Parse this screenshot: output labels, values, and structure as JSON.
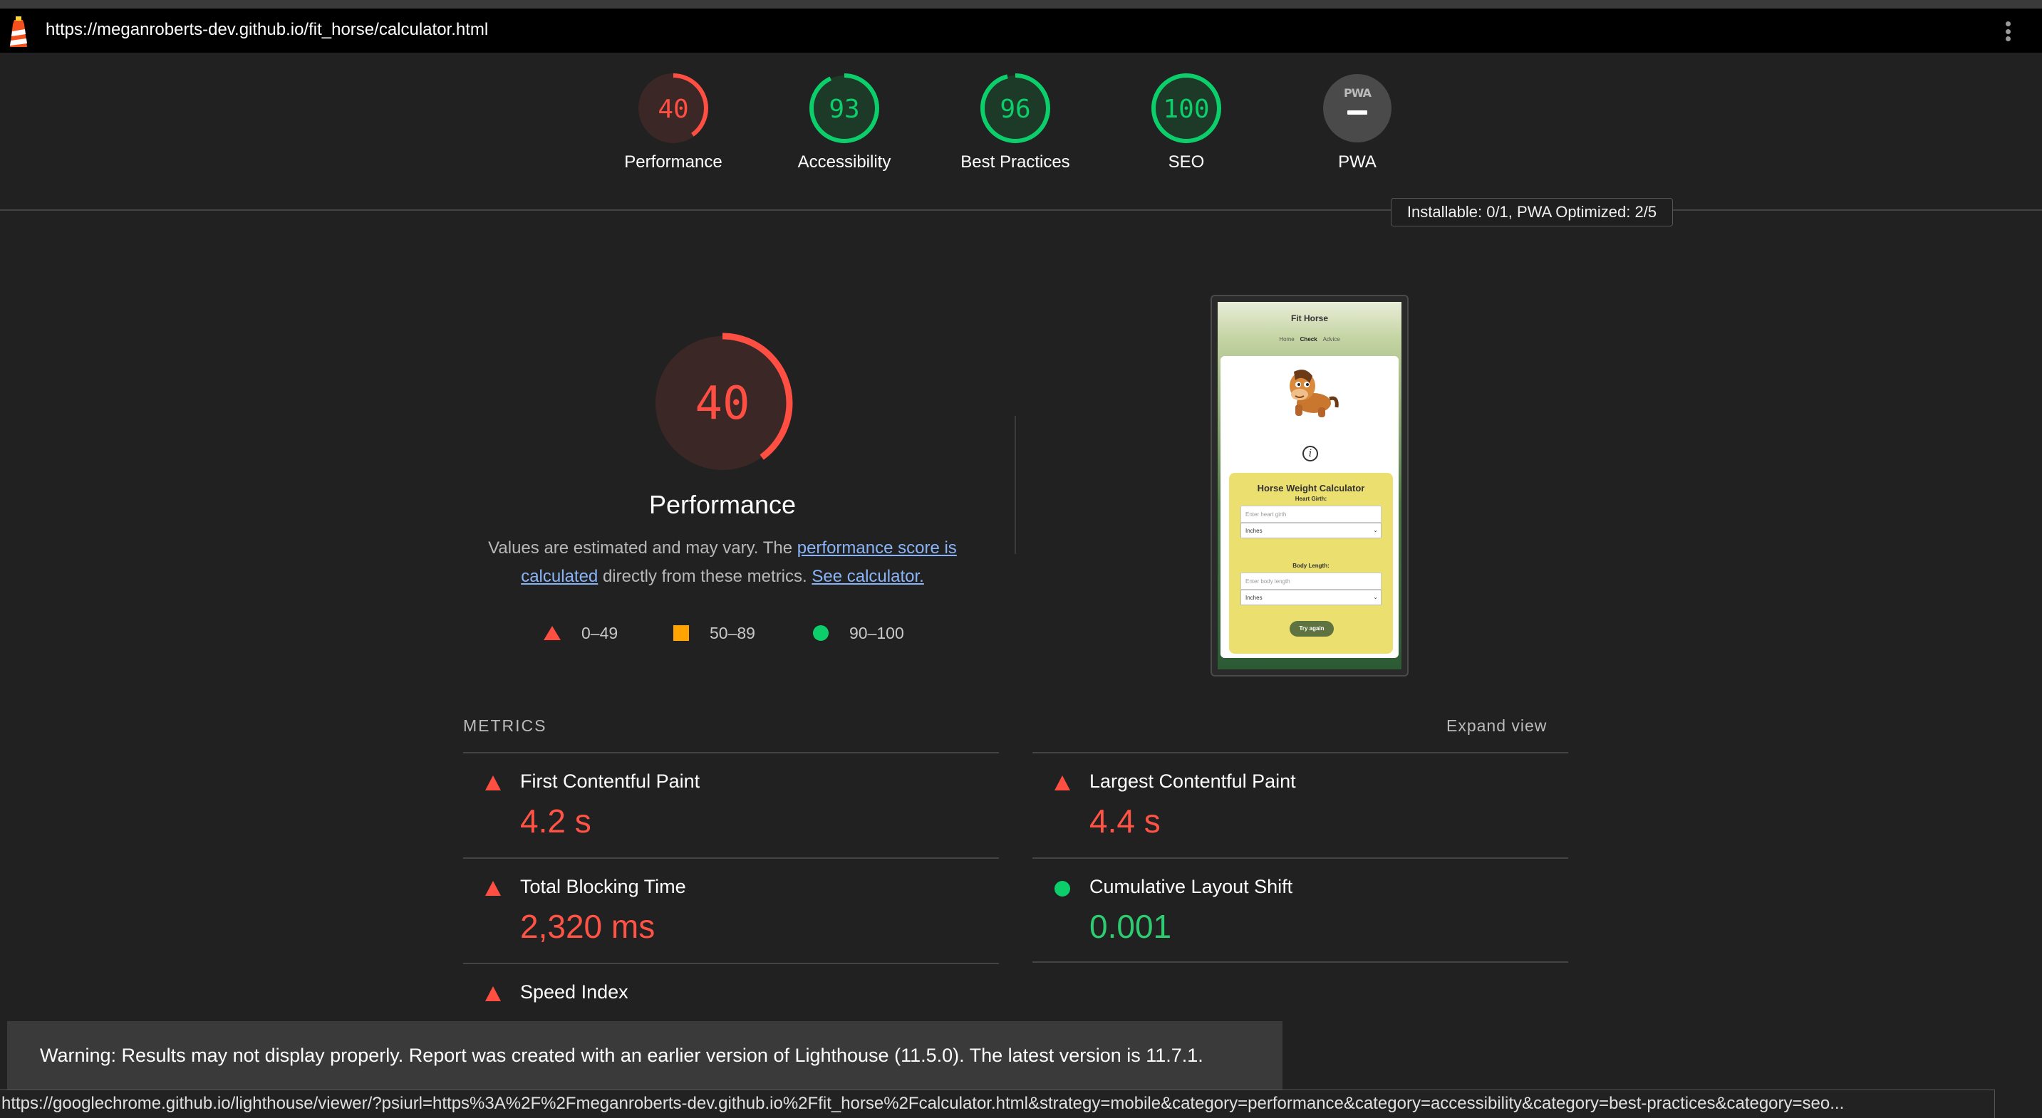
{
  "browser": {
    "url": "https://meganroberts-dev.github.io/fit_horse/calculator.html"
  },
  "gauges": [
    {
      "label": "Performance",
      "score": "40",
      "value": 0.4,
      "status": "fail"
    },
    {
      "label": "Accessibility",
      "score": "93",
      "value": 0.93,
      "status": "pass"
    },
    {
      "label": "Best Practices",
      "score": "96",
      "value": 0.96,
      "status": "pass"
    },
    {
      "label": "SEO",
      "score": "100",
      "value": 1.0,
      "status": "pass"
    },
    {
      "label": "PWA",
      "badge": "PWA",
      "status": "na"
    }
  ],
  "pwa_tooltip": "Installable: 0/1, PWA Optimized: 2/5",
  "performance": {
    "score": "40",
    "value": 0.4,
    "title": "Performance",
    "desc_before": "Values are estimated and may vary. The ",
    "desc_link1": "performance score is calculated",
    "desc_middle": " directly from these metrics. ",
    "desc_link2": "See calculator."
  },
  "legend": [
    {
      "range": "0–49",
      "shape": "triangle",
      "color": "#ff4e42"
    },
    {
      "range": "50–89",
      "shape": "square",
      "color": "#ffa400"
    },
    {
      "range": "90–100",
      "shape": "circle",
      "color": "#0cce6b"
    }
  ],
  "screenshot": {
    "site_title": "Fit Horse",
    "nav": [
      "Home",
      "Check",
      "Advice"
    ],
    "nav_active": "Check",
    "calculator_title": "Horse Weight Calculator",
    "heart_girth_label": "Heart Girth:",
    "heart_girth_placeholder": "Enter heart girth",
    "unit1": "Inches",
    "body_length_label": "Body Length:",
    "body_length_placeholder": "Enter body length",
    "unit2": "Inches",
    "button": "Try again"
  },
  "metrics": {
    "heading": "METRICS",
    "expand": "Expand view",
    "items": [
      {
        "title": "First Contentful Paint",
        "value": "4.2 s",
        "status": "fail"
      },
      {
        "title": "Largest Contentful Paint",
        "value": "4.4 s",
        "status": "fail"
      },
      {
        "title": "Total Blocking Time",
        "value": "2,320 ms",
        "status": "fail"
      },
      {
        "title": "Cumulative Layout Shift",
        "value": "0.001",
        "status": "pass"
      },
      {
        "title": "Speed Index",
        "value": "",
        "status": "fail"
      }
    ]
  },
  "warning": "Warning: Results may not display properly. Report was created with an earlier version of Lighthouse (11.5.0). The latest version is 11.7.1.",
  "status_url": "https://googlechrome.github.io/lighthouse/viewer/?psiurl=https%3A%2F%2Fmeganroberts-dev.github.io%2Ffit_horse%2Fcalculator.html&strategy=mobile&category=performance&category=accessibility&category=best-practices&category=seo..."
}
